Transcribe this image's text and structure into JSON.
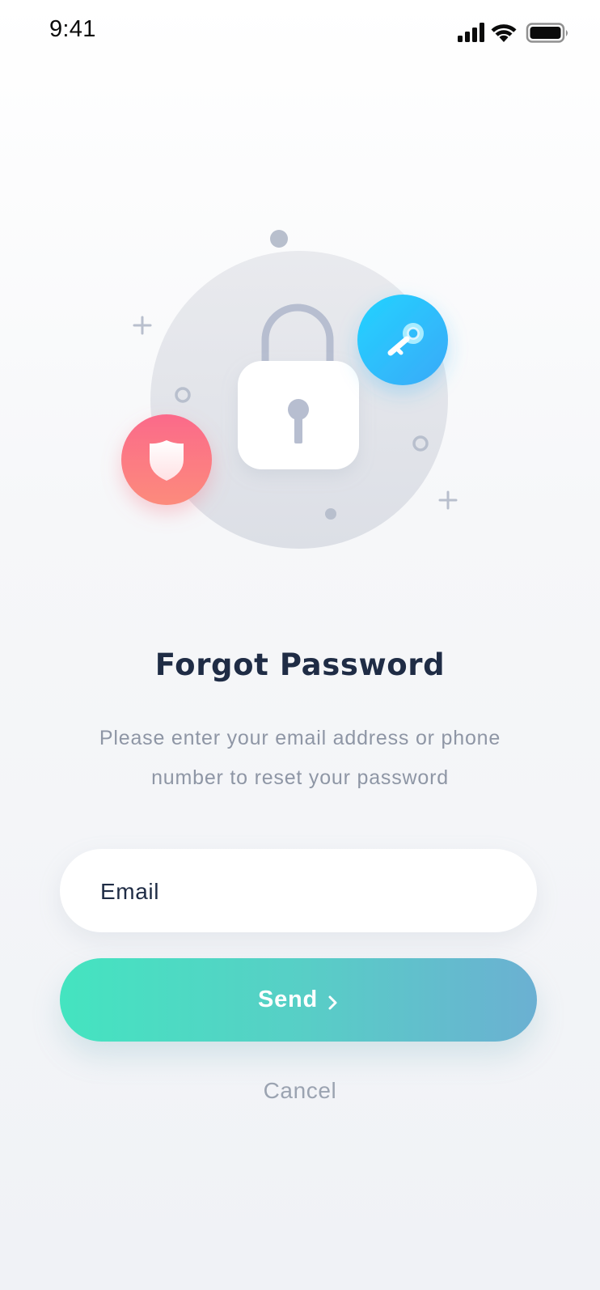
{
  "status_bar": {
    "time": "9:41",
    "icons": [
      "cellular-signal-icon",
      "wifi-icon",
      "battery-icon"
    ]
  },
  "illustration": {
    "icons": [
      "padlock-icon",
      "key-icon",
      "shield-icon"
    ],
    "colors": {
      "backdrop_circle": "#e3e5ea",
      "key_badge": "#29c4fb",
      "shield_badge": "#f96f86",
      "decoration": "#b8bfcd"
    }
  },
  "screen": {
    "title": "Forgot Password",
    "subtitle": "Please enter your email address or phone number to reset your password"
  },
  "form": {
    "email": {
      "placeholder": "Email",
      "value": ""
    },
    "send_label": "Send",
    "cancel_label": "Cancel"
  },
  "colors": {
    "title": "#1f2c45",
    "subtitle": "#8e96a5",
    "button_gradient_start": "#44e4c0",
    "button_gradient_end": "#6bb0d2"
  }
}
